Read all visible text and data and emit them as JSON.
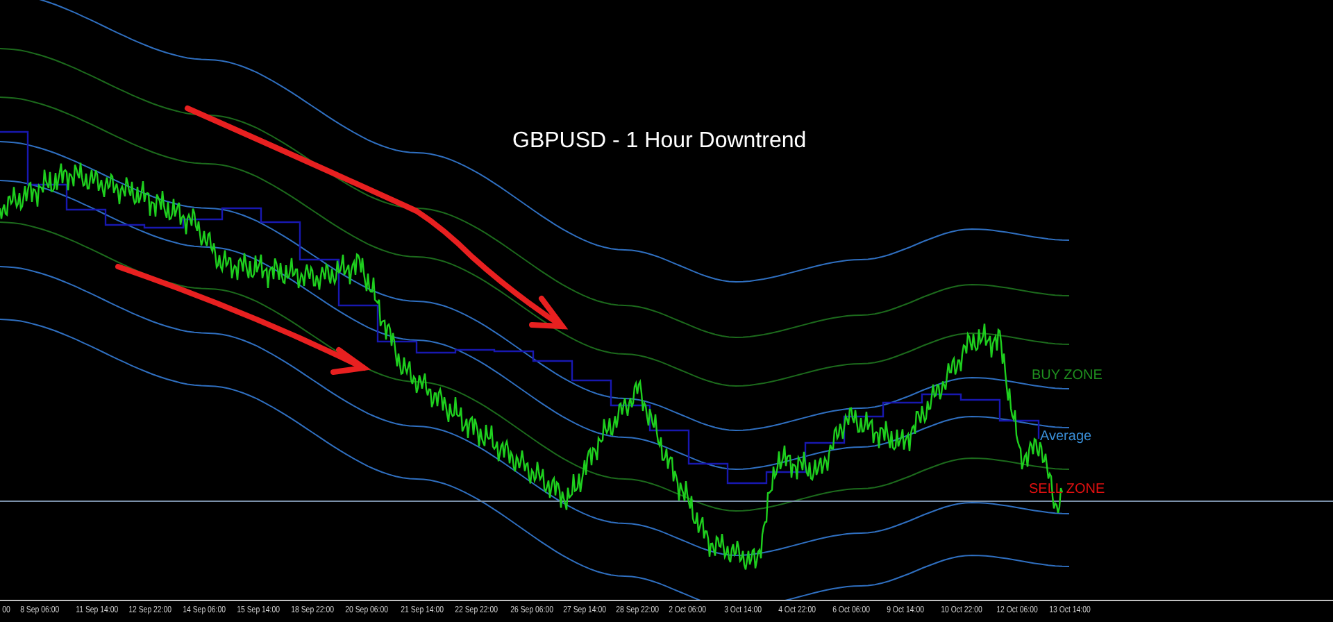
{
  "chart": {
    "title": "GBPUSD - 1 Hour Downtrend",
    "zone_labels": [
      {
        "text": "BUY ZONE",
        "color": "#1f8f1f"
      },
      {
        "text": "Average",
        "color": "#3a8fd8"
      },
      {
        "text": "SELL ZONE",
        "color": "#e01010"
      }
    ],
    "time_axis": [
      "00",
      "8 Sep 06:00",
      "11 Sep 14:00",
      "12 Sep 22:00",
      "14 Sep 06:00",
      "15 Sep 14:00",
      "18 Sep 22:00",
      "20 Sep 06:00",
      "21 Sep 14:00",
      "22 Sep 22:00",
      "26 Sep 06:00",
      "27 Sep 14:00",
      "28 Sep 22:00",
      "2 Oct 06:00",
      "3 Oct 14:00",
      "4 Oct 22:00",
      "6 Oct 06:00",
      "9 Oct 14:00",
      "10 Oct 22:00",
      "12 Oct 06:00",
      "13 Oct 14:00"
    ]
  }
}
